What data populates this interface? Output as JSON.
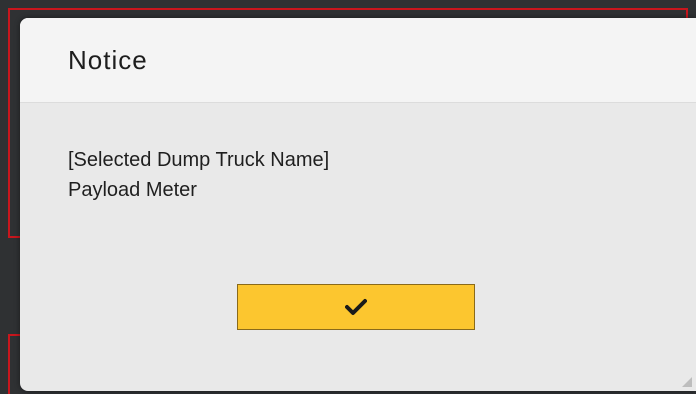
{
  "dialog": {
    "title": "Notice",
    "message_line1": "[Selected Dump Truck Name]",
    "message_line2": "Payload Meter",
    "confirm_icon": "checkmark-icon"
  },
  "colors": {
    "highlight_frame": "#c8161d",
    "button": "#fcc62f",
    "dialog_bg": "#e9e9e9"
  }
}
